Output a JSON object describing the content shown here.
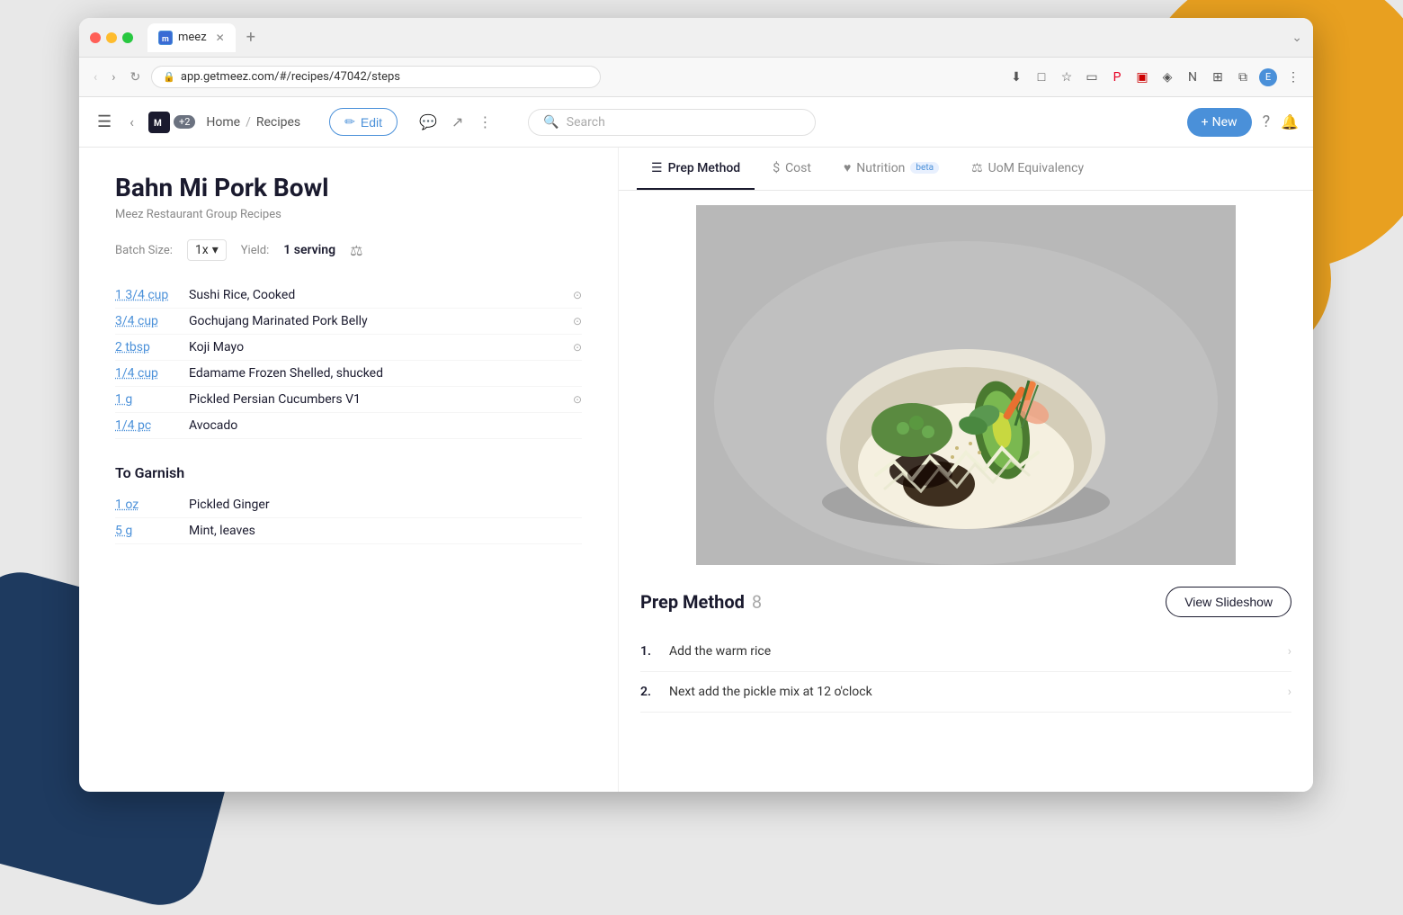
{
  "browser": {
    "url": "app.getmeez.com/#/recipes/47042/steps",
    "tab_title": "meez",
    "tab_favicon": "M"
  },
  "breadcrumb": {
    "home": "Home",
    "separator": "/",
    "recipes": "Recipes"
  },
  "topbar": {
    "edit_label": "Edit",
    "search_placeholder": "Search",
    "new_label": "+ New"
  },
  "recipe": {
    "title": "Bahn Mi Pork Bowl",
    "source": "Meez Restaurant Group Recipes",
    "batch_label": "Batch Size:",
    "batch_value": "1x",
    "yield_label": "Yield:",
    "yield_value": "1 serving"
  },
  "ingredients": [
    {
      "qty": "1 3/4 cup",
      "name": "Sushi Rice, Cooked",
      "has_dropdown": true
    },
    {
      "qty": "3/4 cup",
      "name": "Gochujang Marinated Pork Belly",
      "has_dropdown": true
    },
    {
      "qty": "2 tbsp",
      "name": "Koji Mayo",
      "has_dropdown": true
    },
    {
      "qty": "1/4 cup",
      "name": "Edamame Frozen Shelled, shucked",
      "has_dropdown": false
    },
    {
      "qty": "1 g",
      "name": "Pickled Persian Cucumbers V1",
      "has_dropdown": true
    },
    {
      "qty": "1/4 pc",
      "name": "Avocado",
      "has_dropdown": false
    }
  ],
  "garnish_section": {
    "label": "To Garnish"
  },
  "garnish_ingredients": [
    {
      "qty": "1 oz",
      "name": "Pickled Ginger",
      "has_dropdown": false
    },
    {
      "qty": "5 g",
      "name": "Mint, leaves",
      "has_dropdown": false
    }
  ],
  "tabs": [
    {
      "id": "prep-method",
      "icon": "☰",
      "label": "Prep Method",
      "active": true
    },
    {
      "id": "cost",
      "icon": "$",
      "label": "Cost",
      "active": false
    },
    {
      "id": "nutrition",
      "icon": "♥",
      "label": "Nutrition",
      "active": false,
      "badge": "beta"
    },
    {
      "id": "uom",
      "icon": "⚖",
      "label": "UoM Equivalency",
      "active": false
    }
  ],
  "prep_method": {
    "title": "Prep Method",
    "step_count": "8",
    "slideshow_btn": "View Slideshow",
    "steps": [
      {
        "num": "1.",
        "text": "Add the warm rice"
      },
      {
        "num": "2.",
        "text": "Next add the pickle mix at 12 o'clock"
      }
    ]
  }
}
